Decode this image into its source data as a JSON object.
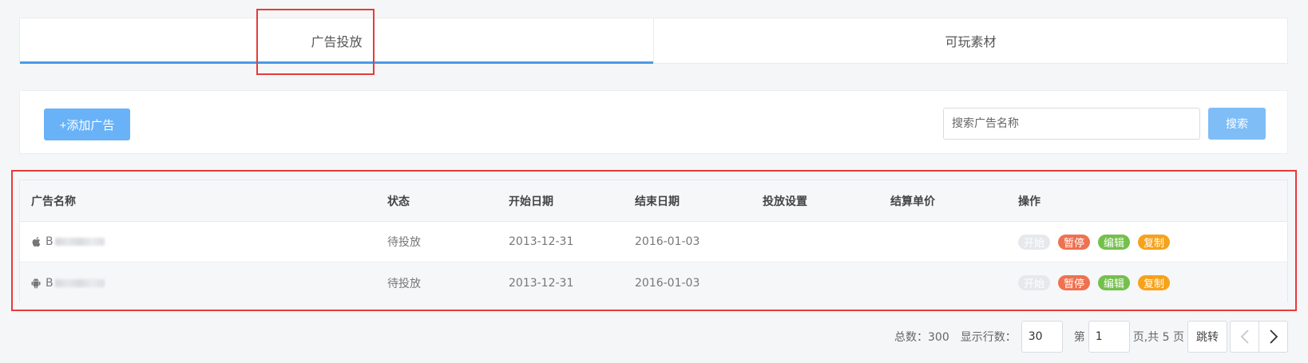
{
  "tabs": [
    {
      "label": "广告投放",
      "active": true
    },
    {
      "label": "可玩素材",
      "active": false
    }
  ],
  "toolbar": {
    "add_label": "+添加广告",
    "search_placeholder": "搜索广告名称",
    "search_label": "搜索"
  },
  "table": {
    "headers": {
      "name": "广告名称",
      "status": "状态",
      "start": "开始日期",
      "end": "结束日期",
      "setting": "投放设置",
      "price": "结算单价",
      "ops": "操作"
    },
    "rows": [
      {
        "platform_icon": "apple-icon",
        "name_initial": "B",
        "status": "待投放",
        "start": "2013-12-31",
        "end": "2016-01-03",
        "setting": "",
        "price": ""
      },
      {
        "platform_icon": "android-icon",
        "name_initial": "B",
        "status": "待投放",
        "start": "2013-12-31",
        "end": "2016-01-03",
        "setting": "",
        "price": ""
      }
    ],
    "ops": {
      "start": "开始",
      "pause": "暂停",
      "edit": "编辑",
      "copy": "复制"
    }
  },
  "pager": {
    "total_label": "总数：300",
    "rows_label": "显示行数：",
    "rows_value": "30",
    "page_prefix": "第",
    "page_value": "1",
    "page_suffix": "页,共 5 页",
    "jump_label": "跳转"
  },
  "colors": {
    "accent": "#4a9be8",
    "primary_button": "#69b2f8",
    "pause": "#f0714f",
    "edit": "#74c04c",
    "copy": "#f7a21b",
    "annotation": "#e83a3a"
  }
}
